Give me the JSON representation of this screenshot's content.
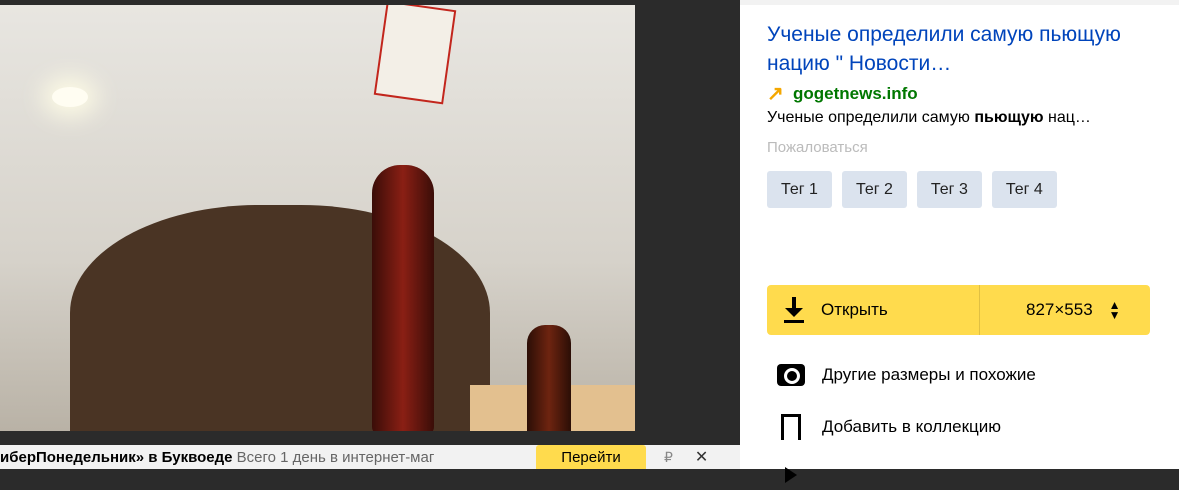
{
  "viewer": {
    "promo_text_bold": "иберПонедельник» в Буквоеде",
    "promo_text": " Всего 1 день в интернет-маг",
    "go_label": "Перейти",
    "ruble": "₽",
    "close": "✕"
  },
  "sidebar": {
    "title": "Ученые определили самую пьющую нацию \" Новости…",
    "source": "gogetnews.info",
    "snippet_pre": "Ученые определили самую ",
    "snippet_bold": "пьющую",
    "snippet_post": " нац…",
    "report_label": "Пожаловаться",
    "tags": [
      {
        "label": "Тег 1"
      },
      {
        "label": "Тег 2"
      },
      {
        "label": "Тег 3"
      },
      {
        "label": "Тег 4"
      }
    ],
    "open_label": "Открыть",
    "size_label": "827×553",
    "actions": [
      {
        "label": "Другие размеры и похожие",
        "icon": "camera-search-icon"
      },
      {
        "label": "Добавить в коллекцию",
        "icon": "bookmark-icon"
      }
    ]
  },
  "colors": {
    "accent": "#ffdb4d",
    "link": "#0044bb",
    "source": "#007700",
    "tag_bg": "#dbe3ee"
  }
}
